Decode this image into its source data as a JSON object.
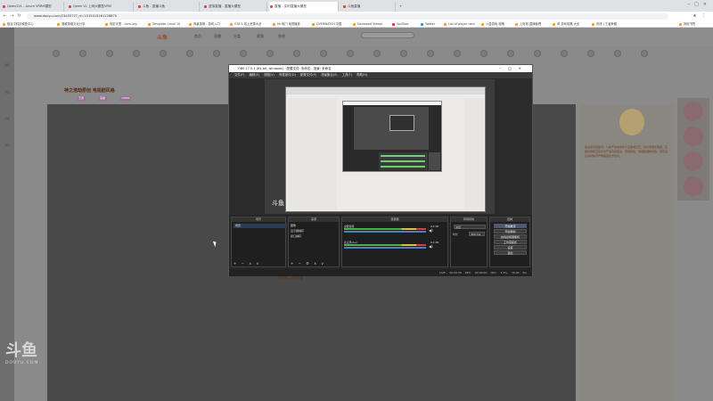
{
  "browser": {
    "tabs": [
      {
        "label": "Qwen2VL - Azure VRRM模型",
        "active": false
      },
      {
        "label": "Qwen VL 上网大模型VRM",
        "active": false
      },
      {
        "label": "斗鱼 - 直播斗鱼",
        "active": false
      },
      {
        "label": "虚拟直播 - 直播大模型",
        "active": false
      },
      {
        "label": "直播 - 实时直播大模型",
        "active": true
      },
      {
        "label": "斗鱼直播",
        "active": false
      }
    ],
    "url": "www.douyu.com/2345577?_rt=1015015261128870",
    "bookmarks": [
      "极目汉科技模型中心",
      "漫威英雄文化分享",
      "电影天堂 - Lims.org",
      "Template: Level 10",
      "风暴英雄 - 游戏入口",
      "GTA 5 线上资源大全",
      "Mr.电门 电视播放",
      "OVERWATCH 中国",
      "Gamepad Viewer",
      "YouTube",
      "Twitter",
      "List of player nam",
      "沙盒游戏 攻略",
      "上斑斑 直播管理",
      "风 游戏攻略 大全",
      "鲁班 | 王者荣耀"
    ],
    "other_bookmarks": "其他书签"
  },
  "douyu": {
    "logo": "斗鱼",
    "nav": [
      "首页",
      "直播",
      "分类",
      "视频",
      "鱼吧"
    ],
    "sidebar": [
      "推荐",
      "关注",
      "分类",
      "排行"
    ],
    "stream_title": "神之浩劫原创 电视剧风格",
    "tags": [
      "王者",
      "英雄",
      "1080P"
    ],
    "right_panel_text": "欢迎来到直播间！斗鱼严禁未成年人直播或打赏，请大家理性消费。直播内容和互动评论严禁包含政治、低俗色情、吸烟酗酒等内容，若有违反将视情节严重程度给予处罚。",
    "below_player": "直播间 - 斗鱼直播",
    "watermark_big": "斗鱼",
    "watermark_small": "DOUYU.COM"
  },
  "obs": {
    "title": "OBS 27.0.1 (64-bit, windows) - 配置文件: 未命名 - 场景: 未命名",
    "menu": [
      "文件(F)",
      "编辑(E)",
      "视图(V)",
      "停靠部件(D)",
      "配置文件(P)",
      "场景集合(S)",
      "工具(T)",
      "帮助(H)"
    ],
    "preview_watermark": "斗鱼",
    "docks": {
      "scenes_title": "场景",
      "scene_item": "场景",
      "sources_title": "来源",
      "sources": [
        "图像",
        "显示器捕获",
        "窗口捕获"
      ],
      "mixer_title": "混音器",
      "mixer": [
        {
          "name": "桌面音频",
          "db": "0.0 dB"
        },
        {
          "name": "麦克风/Aux",
          "db": "0.0 dB"
        }
      ],
      "transitions_title": "转场特效",
      "transition_label": "淡出",
      "duration_label": "时长",
      "duration_value": "300 ms",
      "controls_title": "控制",
      "controls": [
        "开始推流",
        "开始录制",
        "启动虚拟摄像机",
        "工作室模式",
        "设置",
        "退出"
      ]
    },
    "status": "LIVE: 00:00:00   REC: 00:00:00   CPU: 3.4%, 30.00 fps"
  },
  "colors": {
    "obs_bg": "#2b2b2b",
    "browser_chrome": "#dfe1e5",
    "meter_green": "#4caf50"
  }
}
